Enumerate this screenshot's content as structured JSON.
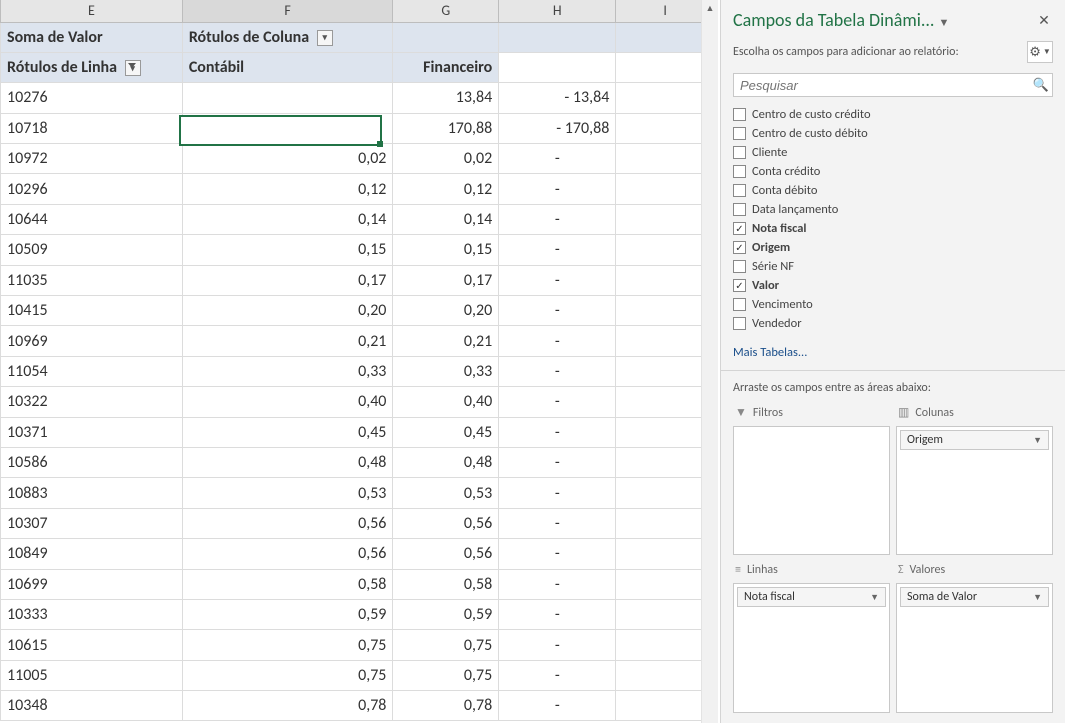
{
  "columns": {
    "E": "E",
    "F": "F",
    "G": "G",
    "H": "H",
    "I": "I"
  },
  "pivot_headers": {
    "soma_valor": "Soma de Valor",
    "rotulos_coluna": "Rótulos de Coluna",
    "rotulos_linha": "Rótulos de Linha",
    "contabil": "Contábil",
    "financeiro": "Financeiro"
  },
  "rows": [
    {
      "id": "10276",
      "contabil": "",
      "financeiro": "13,84",
      "h": "-        13,84"
    },
    {
      "id": "10718",
      "contabil": "",
      "financeiro": "170,88",
      "h": "-      170,88"
    },
    {
      "id": "10972",
      "contabil": "0,02",
      "financeiro": "0,02",
      "h": "-"
    },
    {
      "id": "10296",
      "contabil": "0,12",
      "financeiro": "0,12",
      "h": "-"
    },
    {
      "id": "10644",
      "contabil": "0,14",
      "financeiro": "0,14",
      "h": "-"
    },
    {
      "id": "10509",
      "contabil": "0,15",
      "financeiro": "0,15",
      "h": "-"
    },
    {
      "id": "11035",
      "contabil": "0,17",
      "financeiro": "0,17",
      "h": "-"
    },
    {
      "id": "10415",
      "contabil": "0,20",
      "financeiro": "0,20",
      "h": "-"
    },
    {
      "id": "10969",
      "contabil": "0,21",
      "financeiro": "0,21",
      "h": "-"
    },
    {
      "id": "11054",
      "contabil": "0,33",
      "financeiro": "0,33",
      "h": "-"
    },
    {
      "id": "10322",
      "contabil": "0,40",
      "financeiro": "0,40",
      "h": "-"
    },
    {
      "id": "10371",
      "contabil": "0,45",
      "financeiro": "0,45",
      "h": "-"
    },
    {
      "id": "10586",
      "contabil": "0,48",
      "financeiro": "0,48",
      "h": "-"
    },
    {
      "id": "10883",
      "contabil": "0,53",
      "financeiro": "0,53",
      "h": "-"
    },
    {
      "id": "10307",
      "contabil": "0,56",
      "financeiro": "0,56",
      "h": "-"
    },
    {
      "id": "10849",
      "contabil": "0,56",
      "financeiro": "0,56",
      "h": "-"
    },
    {
      "id": "10699",
      "contabil": "0,58",
      "financeiro": "0,58",
      "h": "-"
    },
    {
      "id": "10333",
      "contabil": "0,59",
      "financeiro": "0,59",
      "h": "-"
    },
    {
      "id": "10615",
      "contabil": "0,75",
      "financeiro": "0,75",
      "h": "-"
    },
    {
      "id": "11005",
      "contabil": "0,75",
      "financeiro": "0,75",
      "h": "-"
    },
    {
      "id": "10348",
      "contabil": "0,78",
      "financeiro": "0,78",
      "h": "-"
    }
  ],
  "pane": {
    "title": "Campos da Tabela Dinâmi...",
    "subtitle": "Escolha os campos para adicionar ao relatório:",
    "search_placeholder": "Pesquisar",
    "more_tables": "Mais Tabelas...",
    "drag_hint": "Arraste os campos entre as áreas abaixo:",
    "fields": [
      {
        "label": "Centro de custo crédito",
        "checked": false
      },
      {
        "label": "Centro de custo débito",
        "checked": false
      },
      {
        "label": "Cliente",
        "checked": false
      },
      {
        "label": "Conta crédito",
        "checked": false
      },
      {
        "label": "Conta débito",
        "checked": false
      },
      {
        "label": "Data lançamento",
        "checked": false
      },
      {
        "label": "Nota fiscal",
        "checked": true
      },
      {
        "label": "Origem",
        "checked": true
      },
      {
        "label": "Série NF",
        "checked": false
      },
      {
        "label": "Valor",
        "checked": true
      },
      {
        "label": "Vencimento",
        "checked": false
      },
      {
        "label": "Vendedor",
        "checked": false
      }
    ],
    "areas": {
      "filtros_label": "Filtros",
      "colunas_label": "Colunas",
      "linhas_label": "Linhas",
      "valores_label": "Valores",
      "colunas_item": "Origem",
      "linhas_item": "Nota fiscal",
      "valores_item": "Soma de Valor"
    }
  }
}
